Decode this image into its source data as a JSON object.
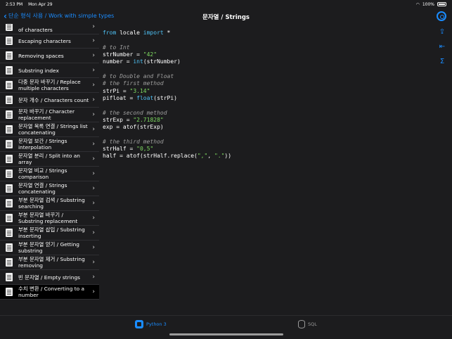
{
  "status_bar": {
    "time": "2:53 PM",
    "date": "Mon Apr 29",
    "battery": "100%"
  },
  "nav": {
    "back_label": "단순 형식 사용 / Work with simple types",
    "title": "문자열 / Strings"
  },
  "sidebar": {
    "items": [
      {
        "label": "of characters",
        "selected": false
      },
      {
        "label": "Escaping characters",
        "selected": false
      },
      {
        "label": "Removing spaces",
        "selected": false
      },
      {
        "label": "Substring index",
        "selected": false
      },
      {
        "label": "다중 문자 바꾸기 / Replace multiple characters",
        "selected": false
      },
      {
        "label": "문자 개수 / Characters count",
        "selected": false
      },
      {
        "label": "문자 바꾸기 / Character replacement",
        "selected": false
      },
      {
        "label": "문자열 목록 연결 / Strings list concatenating",
        "selected": false
      },
      {
        "label": "문자열 보간 / Strings interpolation",
        "selected": false
      },
      {
        "label": "문자열 분리 / Split into an array",
        "selected": false
      },
      {
        "label": "문자열 비교 / Strings comparison",
        "selected": false
      },
      {
        "label": "문자열 연결 / Strings concatenating",
        "selected": false
      },
      {
        "label": "부분 문자열 검색 / Substring searching",
        "selected": false
      },
      {
        "label": "부분 문자열 바꾸기 / Substring replacement",
        "selected": false
      },
      {
        "label": "부분 문자열 삽입 / Substring inserting",
        "selected": false
      },
      {
        "label": "부분 문자열 얻기 / Getting substring",
        "selected": false
      },
      {
        "label": "부분 문자열 제거 / Substring removing",
        "selected": false
      },
      {
        "label": "빈 문자열 / Empty strings",
        "selected": false
      },
      {
        "label": "수치 변환 / Converting to a number",
        "selected": true
      }
    ]
  },
  "code": {
    "lines": [
      "from locale import *",
      "",
      "# to Int",
      "strNumber = \"42\"",
      "number = int(strNumber)",
      "",
      "# to Double and Float",
      "# the first method",
      "strPi = \"3.14\"",
      "pifloat = float(strPi)",
      "",
      "# the second method",
      "strExp = \"2.71828\"",
      "exp = atof(strExp)",
      "",
      "# the third method",
      "strHalf = \"0,5\"",
      "half = atof(strHalf.replace(\",\", \".\"))"
    ]
  },
  "tools": [
    "share-icon",
    "skip-back-icon",
    "sigma-icon"
  ],
  "tabs": [
    {
      "label": "Python 3",
      "icon": "python-icon",
      "active": true
    },
    {
      "label": "SQL",
      "icon": "database-icon",
      "active": false
    }
  ],
  "colors": {
    "accent": "#1a8cff",
    "background": "#1c1c1e",
    "keyword": "#4fc3f7",
    "string": "#7fdc62",
    "comment": "#9e9e9e"
  }
}
